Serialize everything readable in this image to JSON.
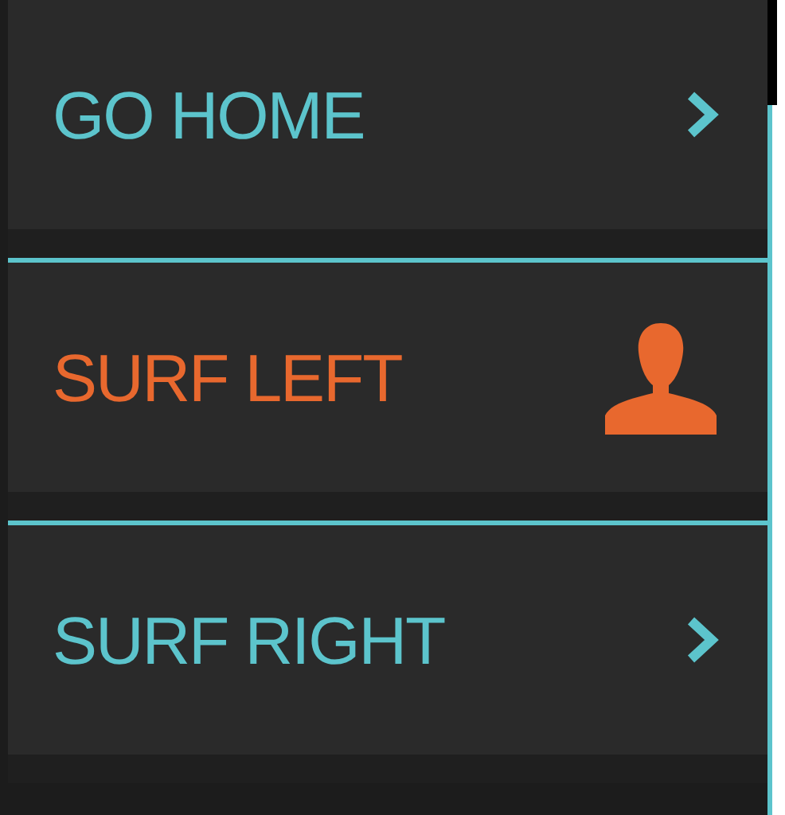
{
  "menu": [
    {
      "label": "GO HOME",
      "selected": false,
      "kind": "chevron"
    },
    {
      "label": "SURF LEFT",
      "selected": true,
      "kind": "person"
    },
    {
      "label": "SURF RIGHT",
      "selected": false,
      "kind": "chevron"
    }
  ]
}
